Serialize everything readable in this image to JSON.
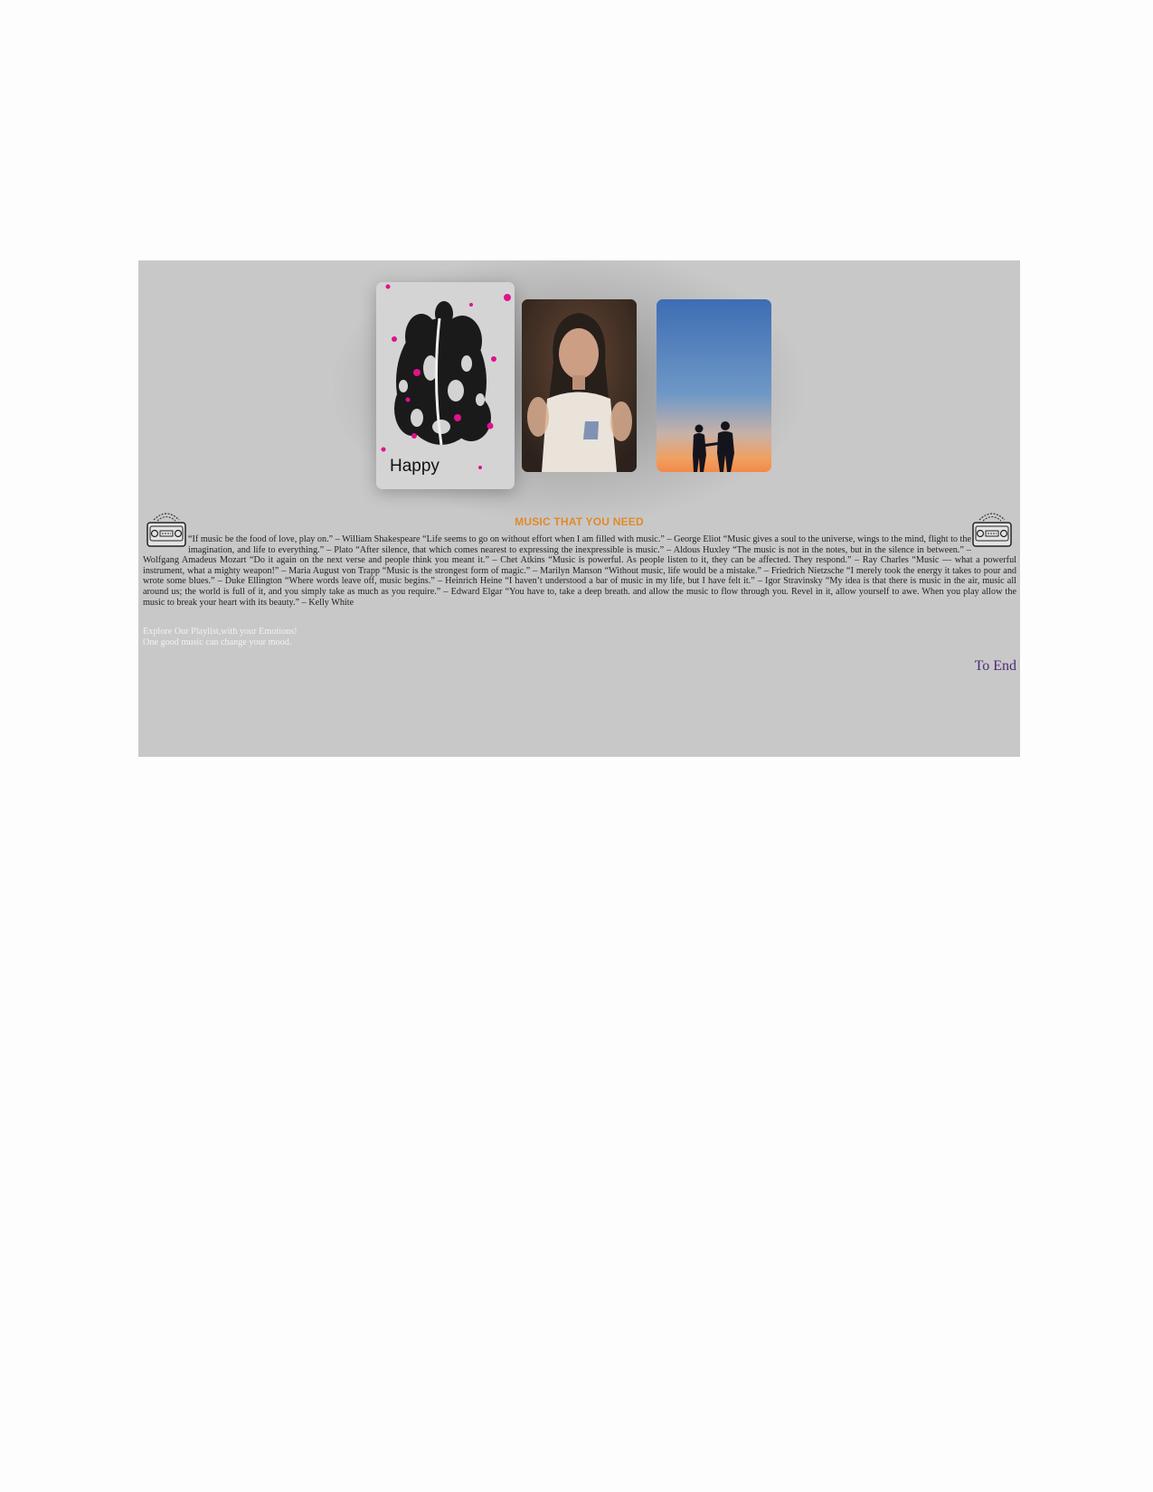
{
  "cards": {
    "happy_label": "Happy"
  },
  "section": {
    "heading": "MUSIC THAT YOU NEED",
    "quotes": "“If music be the food of love, play on.” – William Shakespeare “Life seems to go on without effort when I am filled with music.” – George Eliot “Music gives a soul to the universe, wings to the mind, flight to the imagination, and life to everything.” – Plato “After silence, that which comes nearest to expressing the inexpressible is music.” – Aldous Huxley “The music is not in the notes, but in the silence in between.” – Wolfgang Amadeus Mozart “Do it again on the next verse and people think you meant it.” – Chet Atkins “Music is powerful. As people listen to it, they can be affected. They respond.” – Ray Charles “Music — what a powerful instrument, what a mighty weapon!” – Maria August von Trapp “Music is the strongest form of magic.” – Marilyn Manson “Without music, life would be a mistake.” – Friedrich Nietzsche “I merely took the energy it takes to pour and wrote some blues.” – Duke Ellington “Where words leave off, music begins.” – Heinrich Heine “I haven’t understood a bar of music in my life, but I have felt it.” – Igor Stravinsky “My idea is that there is music in the air, music all around us; the world is full of it, and you simply take as much as you require.” – Edward Elgar “You have to, take a deep breath. and allow the music to flow through you. Revel in it, allow yourself to awe. When you play allow the music to break your heart with its beauty.” – Kelly White",
    "explore_line1": "Explore Our Playlist,with your Emotions!",
    "explore_line2": "One good music can change your mood."
  },
  "nav": {
    "to_end": "To End"
  },
  "colors": {
    "panel_bg": "#c8c8c8",
    "heading": "#e08a2a",
    "link": "#4b2a7a",
    "explore_text": "#f2f2f2",
    "accent_pink": "#e0128a"
  },
  "icons": {
    "radio": "radio-icon",
    "happy_art": "music-collage-image",
    "girl_photo": "portrait-photo-image",
    "sunset_photo": "couple-sunset-image"
  }
}
